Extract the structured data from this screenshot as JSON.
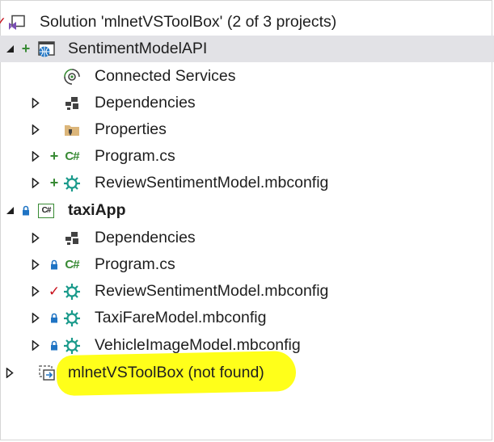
{
  "solution": {
    "label": "Solution 'mlnetVSToolBox' (2 of 3 projects)"
  },
  "tree": {
    "sentiment_api": {
      "label": "SentimentModelAPI",
      "connected_services": "Connected Services",
      "dependencies": "Dependencies",
      "properties": "Properties",
      "program": "Program.cs",
      "review_model": "ReviewSentimentModel.mbconfig"
    },
    "taxi_app": {
      "label": "taxiApp",
      "dependencies": "Dependencies",
      "program": "Program.cs",
      "review_model": "ReviewSentimentModel.mbconfig",
      "taxi_fare": "TaxiFareModel.mbconfig",
      "vehicle_image": "VehicleImageModel.mbconfig"
    },
    "toolbox": {
      "label": "mlnetVSToolBox (not found)"
    }
  },
  "icon_names": {
    "solution": "vs-solution-icon",
    "web_project": "web-project-icon",
    "csharp_project": "csharp-project-icon",
    "connected": "connected-services-icon",
    "dependencies": "dependencies-icon",
    "properties": "properties-folder-icon",
    "csharp_file": "csharp-file-icon",
    "mbconfig": "mbconfig-gear-icon",
    "lock": "lock-icon",
    "plus": "plus-icon",
    "check": "checkmark-icon",
    "unloaded": "unloaded-project-icon"
  },
  "colors": {
    "selection": "#e2e2e6",
    "highlight": "#ffff1a",
    "add_green": "#388a34",
    "lock_blue": "#1f74c4",
    "check_red": "#c8101b",
    "gear_teal": "#1a9a8b"
  }
}
